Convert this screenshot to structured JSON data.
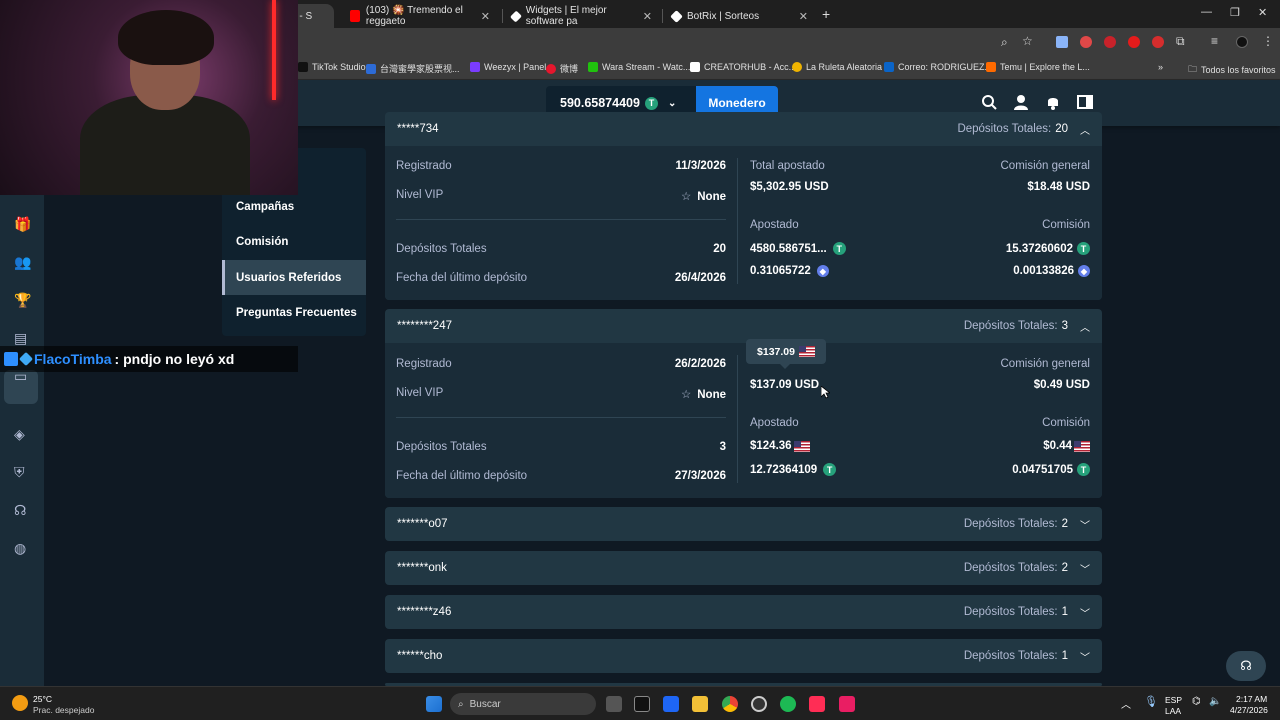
{
  "browser": {
    "tabs": [
      {
        "label": "os - S",
        "favicon_color": "#1a2c38"
      },
      {
        "label": "(103) 🎇 Tremendo el reggaeto",
        "favicon_color": "#ff0000"
      },
      {
        "label": "Widgets | El mejor software pa",
        "favicon_color": "#ffffff"
      },
      {
        "label": "BotRix | Sorteos",
        "favicon_color": "#ffffff"
      }
    ],
    "new_tab": "+",
    "bookmarks": [
      {
        "label": "TikTok Studio",
        "color": "#111111"
      },
      {
        "label": "台灣蜜學家股票视...",
        "color": "#2d6bd6"
      },
      {
        "label": "Weezyx | Panel",
        "color": "#7a3cff"
      },
      {
        "label": "微博",
        "color": "#e6162d"
      },
      {
        "label": "Wara Stream - Watc...",
        "color": "#20c20e"
      },
      {
        "label": "CREATORHUB - Acc...",
        "color": "#ffffff"
      },
      {
        "label": "La Ruleta Aleatoria",
        "color": "#f0b400"
      },
      {
        "label": "Correo: RODRIGUEZ...",
        "color": "#0a64c8"
      },
      {
        "label": "Temu | Explore the L...",
        "color": "#ff6a00"
      }
    ],
    "favorites": "Todos los favoritos",
    "more": "»"
  },
  "header": {
    "balance": "590.65874409",
    "balance_currency_icon": "tether-icon",
    "wallet_label": "Monedero"
  },
  "submenu": {
    "items": [
      {
        "label": "Campañas"
      },
      {
        "label": "Comisión"
      },
      {
        "label": "Usuarios Referidos"
      },
      {
        "label": "Preguntas Frecuentes"
      }
    ]
  },
  "referrals": [
    {
      "username": "*****734",
      "deposits_label": "Depósitos Totales:",
      "deposits": "20",
      "expanded": true,
      "registered_label": "Registrado",
      "registered": "11/3/2026",
      "vip_label": "Nivel VIP",
      "vip": "None",
      "total_deposits_label": "Depósitos Totales",
      "total_deposits": "20",
      "last_deposit_label": "Fecha del último depósito",
      "last_deposit": "26/4/2026",
      "total_wagered_label": "Total apostado",
      "total_wagered": "$5,302.95 USD",
      "general_commission_label": "Comisión general",
      "general_commission": "$18.48 USD",
      "wagered_label": "Apostado",
      "commission_label": "Comisión",
      "wagered_1": "4580.586751...",
      "commission_1": "15.37260602",
      "wagered_2": "0.31065722",
      "commission_2": "0.00133826"
    },
    {
      "username": "********247",
      "deposits_label": "Depósitos Totales:",
      "deposits": "3",
      "expanded": true,
      "registered_label": "Registrado",
      "registered": "26/2/2026",
      "vip_label": "Nivel VIP",
      "vip": "None",
      "total_deposits_label": "Depósitos Totales",
      "total_deposits": "3",
      "last_deposit_label": "Fecha del último depósito",
      "last_deposit": "27/3/2026",
      "total_wagered": "$137.09 USD",
      "general_commission_label": "Comisión general",
      "general_commission": "$0.49 USD",
      "wagered_label": "Apostado",
      "commission_label": "Comisión",
      "wagered_1": "$124.36",
      "commission_1": "$0.44",
      "wagered_2": "12.72364109",
      "commission_2": "0.04751705",
      "tooltip": "$137.09"
    },
    {
      "username": "*******o07",
      "deposits_label": "Depósitos Totales:",
      "deposits": "2"
    },
    {
      "username": "*******onk",
      "deposits_label": "Depósitos Totales:",
      "deposits": "2"
    },
    {
      "username": "********z46",
      "deposits_label": "Depósitos Totales:",
      "deposits": "1"
    },
    {
      "username": "******cho",
      "deposits_label": "Depósitos Totales:",
      "deposits": "1"
    }
  ],
  "overlay": {
    "chat_user": "FlacoTimba",
    "chat_message": ": pndjo no leyó xd"
  },
  "taskbar": {
    "weather_temp": "25°C",
    "weather_desc": "Prac. despejado",
    "search_placeholder": "Buscar",
    "lang_1": "ESP",
    "lang_2": "LAA",
    "time": "2:17 AM",
    "date": "4/27/2026"
  }
}
